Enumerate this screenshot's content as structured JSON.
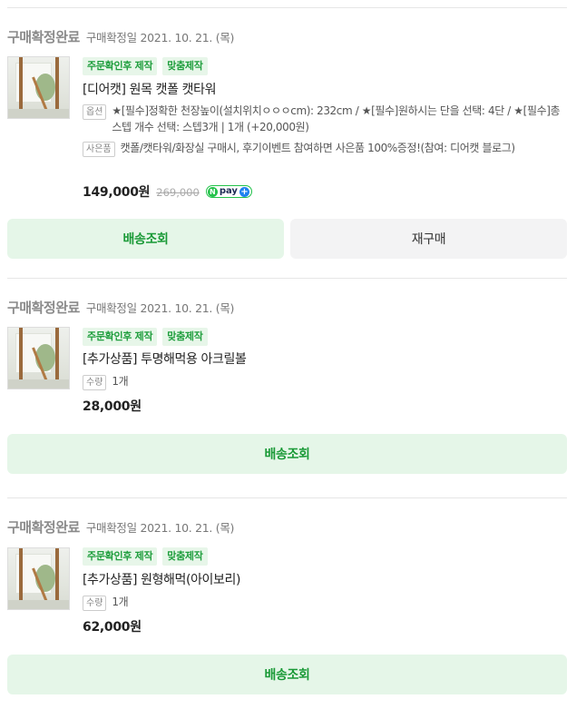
{
  "orders": [
    {
      "status": "구매확정완료",
      "confirm_date": "구매확정일 2021. 10. 21. (목)",
      "tags": [
        "주문확인후 제작",
        "맞춤제작"
      ],
      "title": "[디어캣] 원목 캣폴 캣타워",
      "option_label": "옵션",
      "option_text": "★[필수]정확한 천장높이(설치위치ㅇㅇㅇcm): 232cm / ★[필수]원하시는 단을 선택: 4단 / ★[필수]총 스텝 개수 선택: 스텝3개 | 1개 (+20,000원)",
      "gift_label": "사은품",
      "gift_text": "캣폴/캣타워/화장실 구매시, 후기이벤트 참여하면 사은품 100%증정!(참여: 디어캣 블로그)",
      "price": "149,000원",
      "original_price": "269,000",
      "npay_label": "pay",
      "buttons": [
        "배송조회",
        "재구매"
      ]
    },
    {
      "status": "구매확정완료",
      "confirm_date": "구매확정일 2021. 10. 21. (목)",
      "tags": [
        "주문확인후 제작",
        "맞춤제작"
      ],
      "title": "[추가상품] 투명해먹용 아크릴볼",
      "qty_label": "수량",
      "qty": "1개",
      "price": "28,000원",
      "buttons": [
        "배송조회"
      ]
    },
    {
      "status": "구매확정완료",
      "confirm_date": "구매확정일 2021. 10. 21. (목)",
      "tags": [
        "주문확인후 제작",
        "맞춤제작"
      ],
      "title": "[추가상품] 원형해먹(아이보리)",
      "qty_label": "수량",
      "qty": "1개",
      "price": "62,000원",
      "buttons": [
        "배송조회"
      ]
    }
  ],
  "colors": {
    "accent": "#1a9a37",
    "tag_bg": "#e7f6e9",
    "green_button_bg": "#e5f6e8",
    "gray_button_bg": "#f3f3f4"
  }
}
